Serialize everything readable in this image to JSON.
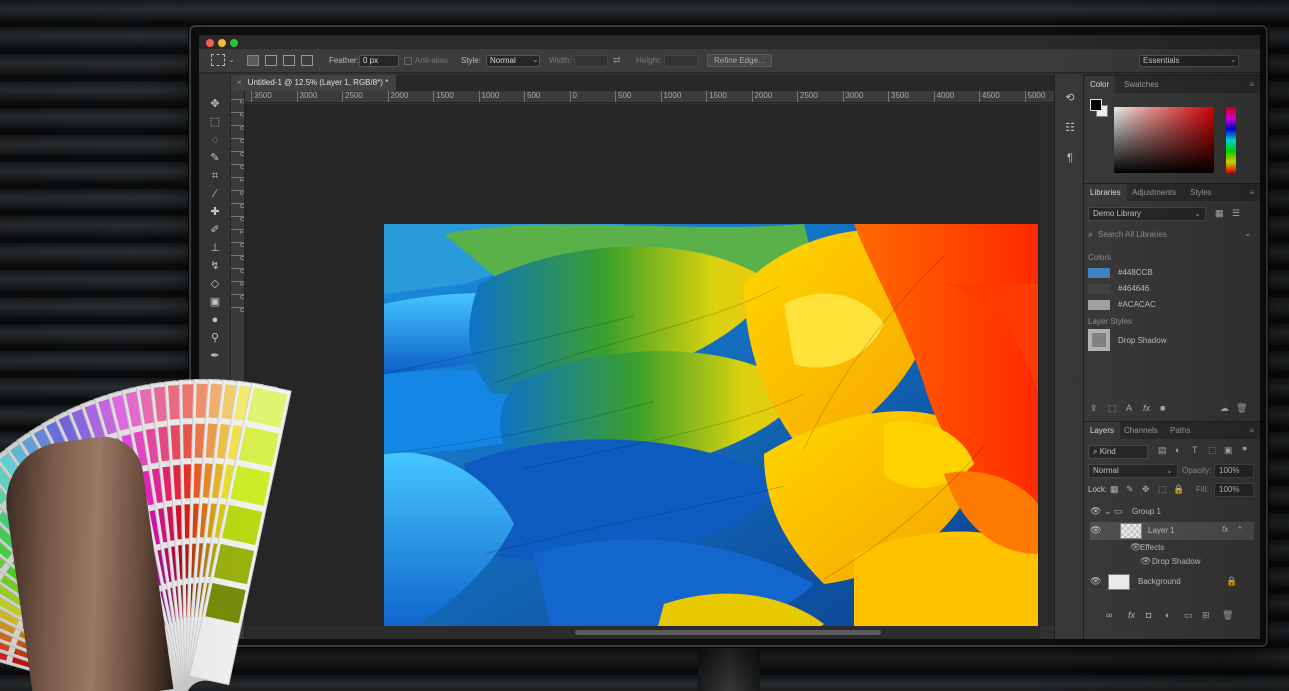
{
  "app": {
    "document_tab": "Untitled-1 @ 12.5% (Layer 1, RGB/8*) *",
    "tab_close": "×",
    "workspace": "Essentials"
  },
  "options_bar": {
    "feather_label": "Feather:",
    "feather_value": "0 px",
    "anti_alias_label": "Anti-alias",
    "style_label": "Style:",
    "style_value": "Normal",
    "width_label": "Width:",
    "height_label": "Height:",
    "refine_edge": "Refine Edge..."
  },
  "ruler": {
    "h_ticks": [
      "3500",
      "3000",
      "2500",
      "2000",
      "1500",
      "1000",
      "500",
      "0",
      "500",
      "1000",
      "1500",
      "2000",
      "2500",
      "3000",
      "3500",
      "4000",
      "4500",
      "5000"
    ],
    "v_ticks": [
      "2",
      "2",
      "0",
      "0",
      "0",
      "0",
      "1",
      "5",
      "0",
      "0",
      "1",
      "0",
      "0",
      "0",
      "5",
      "0",
      "0"
    ]
  },
  "panels": {
    "color_tabs": [
      "Color",
      "Swatches"
    ],
    "library_tabs": [
      "Libraries",
      "Adjustments",
      "Styles"
    ],
    "library_select": "Demo Library",
    "search_placeholder": "Search All Libraries",
    "colors_heading": "Colors",
    "colors": [
      {
        "label": "#448CCB",
        "hex": "#448CCB"
      },
      {
        "label": "#464646",
        "hex": "#464646"
      },
      {
        "label": "#ACACAC",
        "hex": "#ACACAC"
      }
    ],
    "layer_styles_heading": "Layer Styles",
    "layer_style_item": "Drop Shadow",
    "layers_tabs": [
      "Layers",
      "Channels",
      "Paths"
    ],
    "kind_filter": "Kind",
    "blend_mode": "Normal",
    "opacity_label": "Opacity:",
    "opacity_value": "100%",
    "lock_label": "Lock:",
    "fill_label": "Fill:",
    "fill_value": "100%",
    "layers": {
      "group": "Group 1",
      "layer1": "Layer 1",
      "effects": "Effects",
      "drop_shadow": "Drop Shadow",
      "background": "Background",
      "fx": "fx"
    }
  },
  "colors": {
    "foreground": "#000000",
    "background": "#ffffff",
    "accent_blue": "#448CCB"
  }
}
